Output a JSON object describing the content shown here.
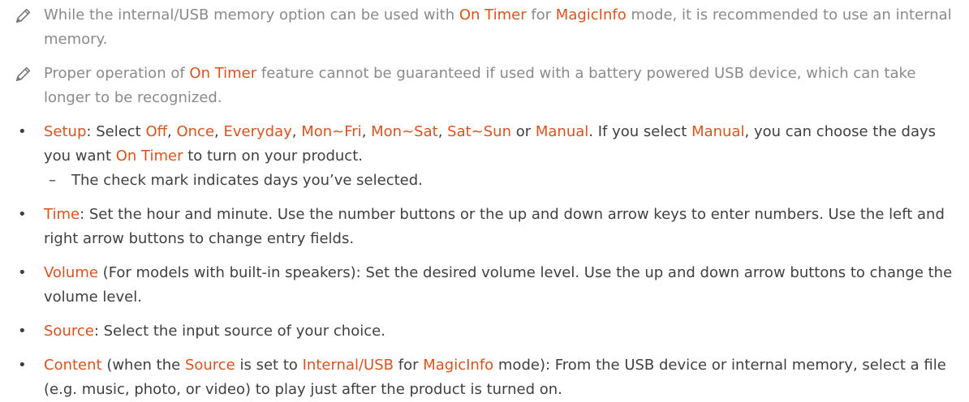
{
  "notes": [
    {
      "icon": "pencil-icon",
      "p1": "While the internal/USB memory option can be used with ",
      "k1": "On Timer",
      "p2": " for ",
      "k2": "MagicInfo",
      "p3": " mode, it is recommended to use an internal memory."
    },
    {
      "icon": "pencil-icon",
      "p1": "Proper operation of ",
      "k1": "On Timer",
      "p2": " feature cannot be guaranteed if used with a battery powered USB device, which can take longer to be recognized."
    }
  ],
  "bullet_glyph": "•",
  "dash_glyph": "–",
  "setup": {
    "term": "Setup",
    "t1": ": Select ",
    "off": "Off",
    "once": "Once",
    "everyday": "Everyday",
    "monfri": "Mon~Fri",
    "monsat": "Mon~Sat",
    "satsun": "Sat~Sun",
    "manual": "Manual",
    "sep": ", ",
    "or": " or ",
    "t2": ". If you select ",
    "t3": ", you can choose the days you want ",
    "ontimer": "On Timer",
    "t4": " to turn on your product.",
    "sub": "The check mark indicates days you’ve selected."
  },
  "time": {
    "term": "Time",
    "text": ": Set the hour and minute. Use the number buttons or the up and down arrow keys to enter numbers. Use the left and right arrow buttons to change entry fields."
  },
  "volume": {
    "term": "Volume",
    "text": " (For models with built-in speakers): Set the desired volume level. Use the up and down arrow buttons to change the volume level."
  },
  "source": {
    "term": "Source",
    "text": ": Select the input source of your choice."
  },
  "content": {
    "term": "Content",
    "t1": " (when the ",
    "source": "Source",
    "t2": " is set to ",
    "internal": "Internal/USB",
    "t3": " for ",
    "magicinfo": "MagicInfo",
    "t4": " mode): From the USB device or internal memory, select a file (e.g. music, photo, or video) to play just after the product is turned on."
  },
  "colors": {
    "highlight": "#d9531e",
    "note_text": "#8a8a8a",
    "body_text": "#404040"
  }
}
